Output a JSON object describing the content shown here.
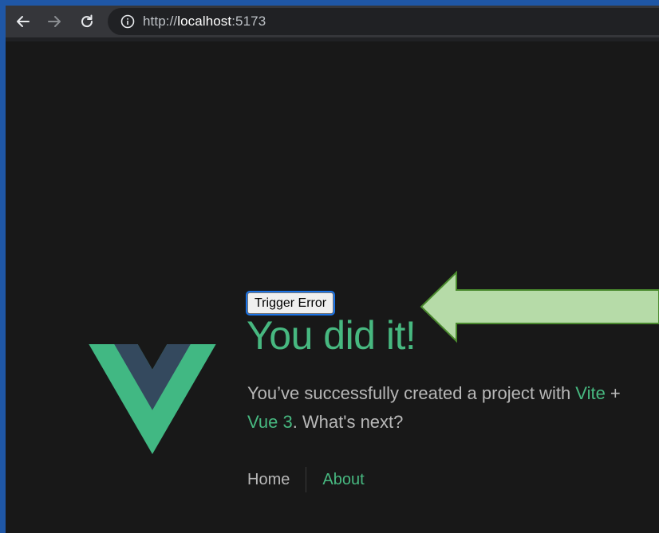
{
  "browser": {
    "url_scheme": "http://",
    "url_host": "localhost",
    "url_port": ":5173"
  },
  "page": {
    "button_label": "Trigger Error",
    "headline": "You did it!",
    "subtitle_prefix": "You’ve successfully created a project with ",
    "link_vite": "Vite",
    "plus": " + ",
    "link_vue": "Vue 3",
    "subtitle_suffix": ". What's next?",
    "nav": {
      "home": "Home",
      "about": "About"
    }
  },
  "colors": {
    "accent_green": "#47b880",
    "arrow_fill": "#b6dba8",
    "arrow_stroke": "#4a8a2e",
    "logo_outer": "#41b883",
    "logo_inner": "#34495e"
  },
  "icons": [
    "back-arrow-icon",
    "forward-arrow-icon",
    "reload-icon",
    "info-icon",
    "vue-logo"
  ]
}
